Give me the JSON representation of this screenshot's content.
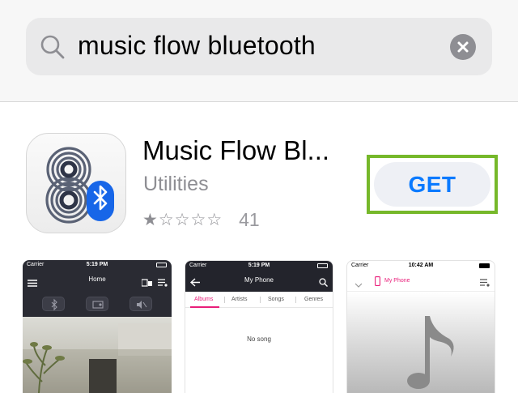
{
  "search": {
    "query": "music flow bluetooth"
  },
  "app": {
    "name": "Music Flow Bl...",
    "category": "Utilities",
    "rating_stars": 1,
    "rating_max": 5,
    "rating_count": "41",
    "get_label": "GET"
  },
  "colors": {
    "accent_blue": "#0a7aff",
    "highlight_green": "#76b82a",
    "brand_pink": "#e91e7a"
  },
  "screenshots": [
    {
      "carrier": "Carrier",
      "time": "5:19 PM",
      "title": "Home",
      "icons": [
        "menu-icon",
        "speaker-group-icon",
        "playlist-icon",
        "bluetooth-icon",
        "radio-icon",
        "volume-icon"
      ]
    },
    {
      "carrier": "Carrier",
      "time": "5:19 PM",
      "title": "My Phone",
      "tabs": [
        "Albums",
        "Artists",
        "Songs",
        "Genres"
      ],
      "empty_text": "No song"
    },
    {
      "carrier": "Carrier",
      "time": "10:42 AM",
      "title": "My Phone"
    }
  ]
}
